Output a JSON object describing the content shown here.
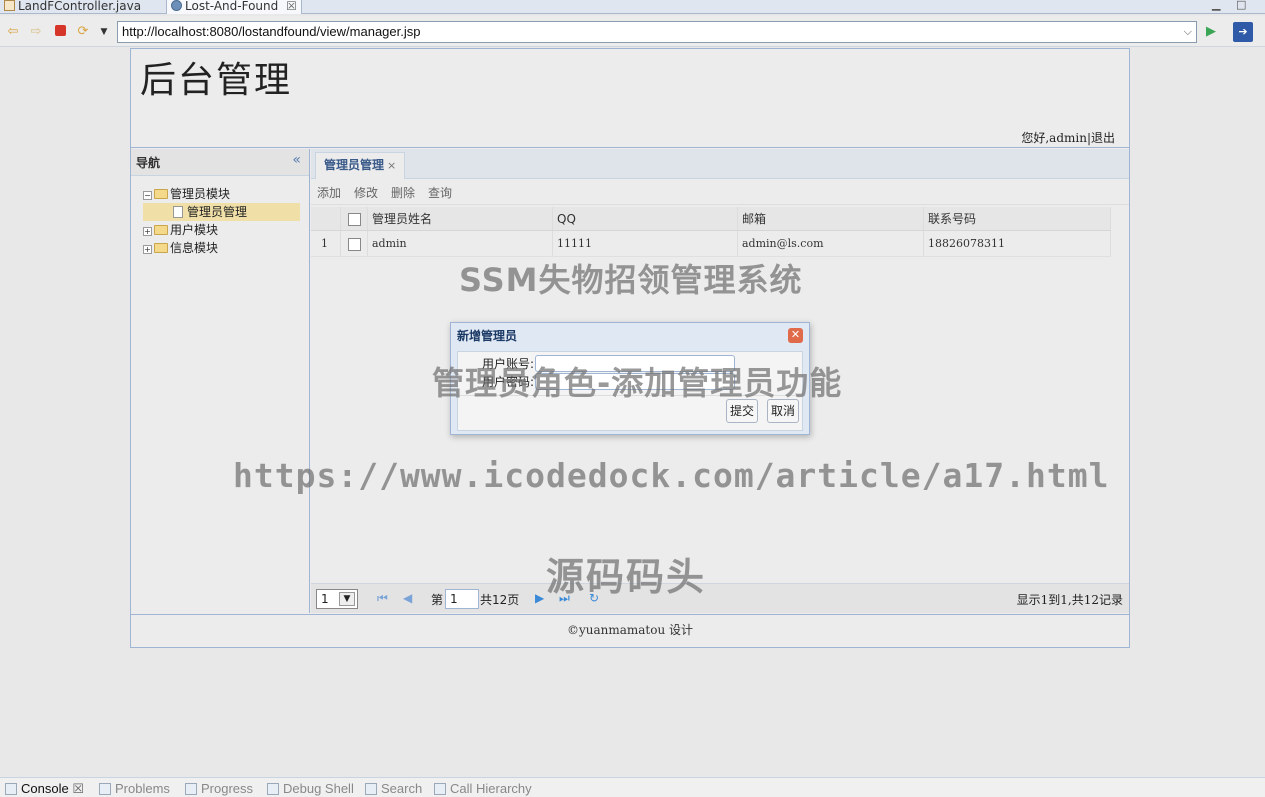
{
  "editor_tabs": [
    {
      "label": "LandFController.java",
      "icon": "java-file-icon"
    },
    {
      "label": "Lost-And-Found",
      "icon": "globe-icon",
      "close": "☒"
    }
  ],
  "browser": {
    "url": "http://localhost:8080/lostandfound/view/manager.jsp"
  },
  "header": {
    "title": "后台管理",
    "greeting": "您好,admin|退出"
  },
  "nav": {
    "title": "导航",
    "collapse": "«",
    "tree": [
      {
        "label": "管理员模块",
        "expander": "−"
      },
      {
        "label": "管理员管理"
      },
      {
        "label": "用户模块",
        "expander": "+"
      },
      {
        "label": "信息模块",
        "expander": "+"
      }
    ]
  },
  "main": {
    "tab_label": "管理员管理",
    "tab_close": "×",
    "toolbar": {
      "add": "添加",
      "edit": "修改",
      "delete": "删除",
      "query": "查询"
    },
    "columns": [
      "管理员姓名",
      "QQ",
      "邮箱",
      "联系号码"
    ],
    "rows": [
      {
        "index": "1",
        "name": "admin",
        "qq": "11111",
        "email": "admin@ls.com",
        "phone": "18826078311"
      }
    ],
    "pager": {
      "page_size": "1",
      "page_prefix": "第",
      "current_page": "1",
      "total_pages": "共12页",
      "info": "显示1到1,共12记录"
    }
  },
  "footer": "©yuanmamatou 设计",
  "dialog": {
    "title": "新增管理员",
    "username_label": "用户账号:",
    "password_label": "用户密码:",
    "submit": "提交",
    "cancel": "取消"
  },
  "watermarks": [
    "SSM失物招领管理系统",
    "管理员角色-添加管理员功能",
    "https://www.icodedock.com/article/a17.html",
    "源码码头"
  ],
  "console_tabs": [
    "Console",
    "Problems",
    "Progress",
    "Debug Shell",
    "Search",
    "Call Hierarchy"
  ],
  "colors": {
    "accent": "#9fb5d3",
    "selected": "#f0e0a8",
    "close_button": "#e06b4a"
  }
}
